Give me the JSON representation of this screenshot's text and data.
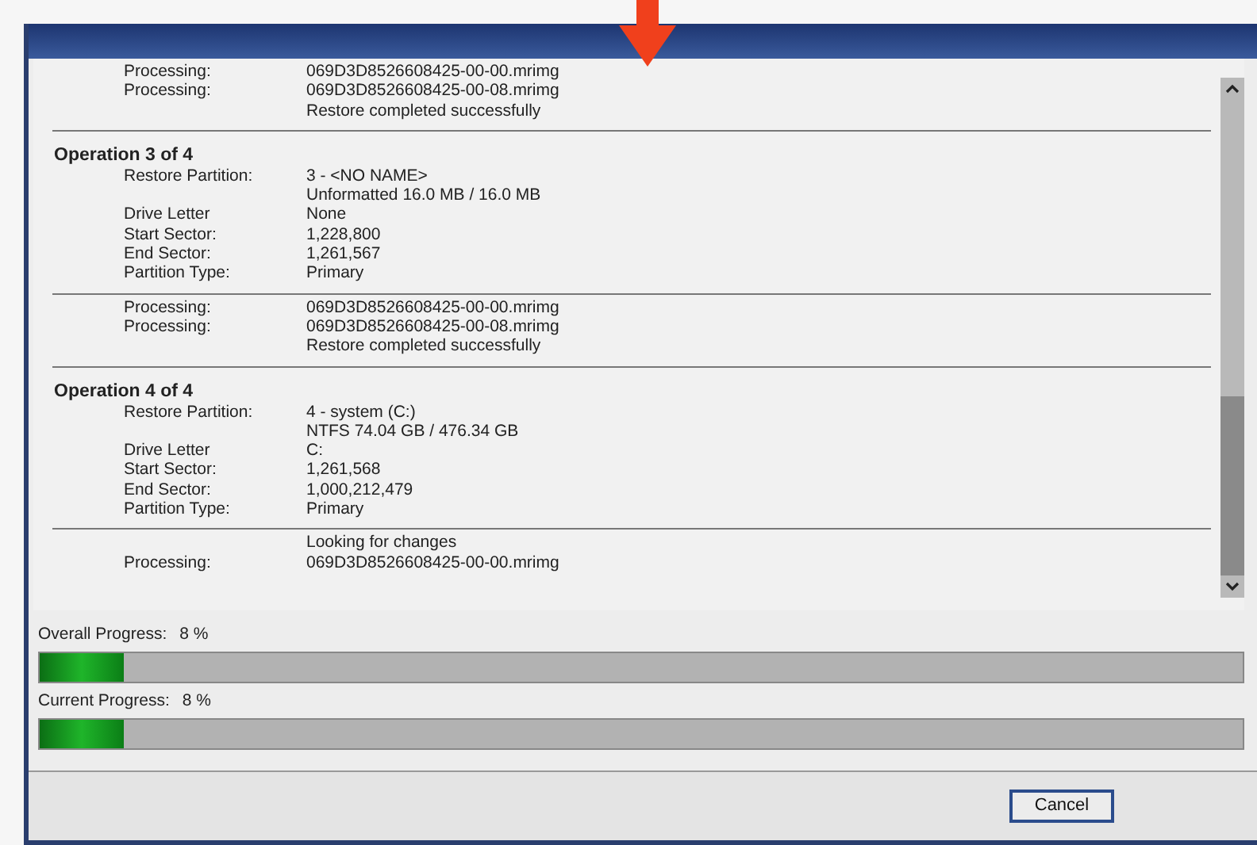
{
  "log": [
    {
      "kind": "processing",
      "rows": [
        {
          "label": "Processing:",
          "value": "069D3D8526608425-00-00.mrimg"
        },
        {
          "label": "Processing:",
          "value": "069D3D8526608425-00-08.mrimg"
        },
        {
          "value": "Restore completed successfully"
        }
      ]
    },
    {
      "kind": "operation",
      "title": "Operation 3 of 4",
      "rows": [
        {
          "label": "Restore Partition:",
          "value": "3 - <NO NAME>"
        },
        {
          "value": "Unformatted 16.0 MB / 16.0 MB"
        },
        {
          "label": "Drive Letter",
          "value": "None"
        },
        {
          "label": "Start Sector:",
          "value": "1,228,800"
        },
        {
          "label": "End Sector:",
          "value": "1,261,567"
        },
        {
          "label": "Partition Type:",
          "value": "Primary"
        }
      ]
    },
    {
      "kind": "processing",
      "rows": [
        {
          "label": "Processing:",
          "value": "069D3D8526608425-00-00.mrimg"
        },
        {
          "label": "Processing:",
          "value": "069D3D8526608425-00-08.mrimg"
        },
        {
          "value": "Restore completed successfully"
        }
      ]
    },
    {
      "kind": "operation",
      "title": "Operation 4 of 4",
      "rows": [
        {
          "label": "Restore Partition:",
          "value": "4 - system (C:)"
        },
        {
          "value": "NTFS 74.04 GB / 476.34 GB"
        },
        {
          "label": "Drive Letter",
          "value": "C:"
        },
        {
          "label": "Start Sector:",
          "value": "1,261,568"
        },
        {
          "label": "End Sector:",
          "value": "1,000,212,479"
        },
        {
          "label": "Partition Type:",
          "value": "Primary"
        }
      ]
    },
    {
      "kind": "processing",
      "rows": [
        {
          "value": "Looking for changes"
        },
        {
          "label": "Processing:",
          "value": "069D3D8526608425-00-00.mrimg"
        }
      ]
    }
  ],
  "progress": [
    {
      "label": "Overall Progress:",
      "reading": "8 %",
      "level": 0.07
    },
    {
      "label": "Current Progress:",
      "reading": "8 %",
      "level": 0.07
    }
  ],
  "buttons": [
    "Cancel"
  ]
}
